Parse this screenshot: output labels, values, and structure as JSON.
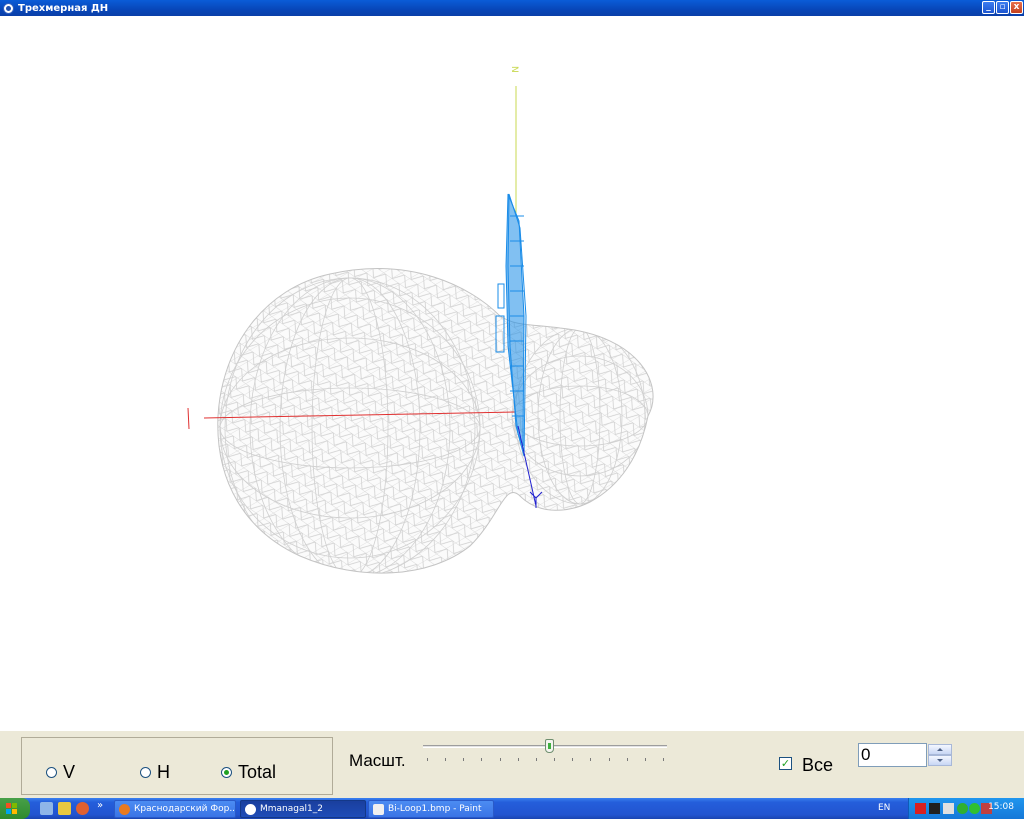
{
  "window": {
    "title": "Трехмерная ДН",
    "buttons": {
      "minimize": "_",
      "restore": "▫",
      "close": "x"
    }
  },
  "view3d": {
    "axis_label_z": "N",
    "colors": {
      "x_axis": "#e03030",
      "z_axis": "#c8d850",
      "y_axis": "#2020d0",
      "element": "#1a8ce8",
      "mesh": "#c8c8c8"
    }
  },
  "controls": {
    "polarization": {
      "options": [
        {
          "label": "V",
          "selected": false
        },
        {
          "label": "H",
          "selected": false
        },
        {
          "label": "Total",
          "selected": true
        }
      ]
    },
    "scale": {
      "label": "Масшт.",
      "value_fraction": 0.5
    },
    "all": {
      "label": "Все",
      "checked": true,
      "check_glyph": "✓"
    },
    "spin": {
      "value": "0"
    }
  },
  "taskbar": {
    "tasks": [
      {
        "label": "Краснодарский Фор...",
        "active": false
      },
      {
        "label": "Mmanagal1_2",
        "active": true
      },
      {
        "label": "Bi-Loop1.bmp - Paint",
        "active": false
      }
    ],
    "quicklaunch_more": "»",
    "language": "EN",
    "clock": "15:08"
  }
}
